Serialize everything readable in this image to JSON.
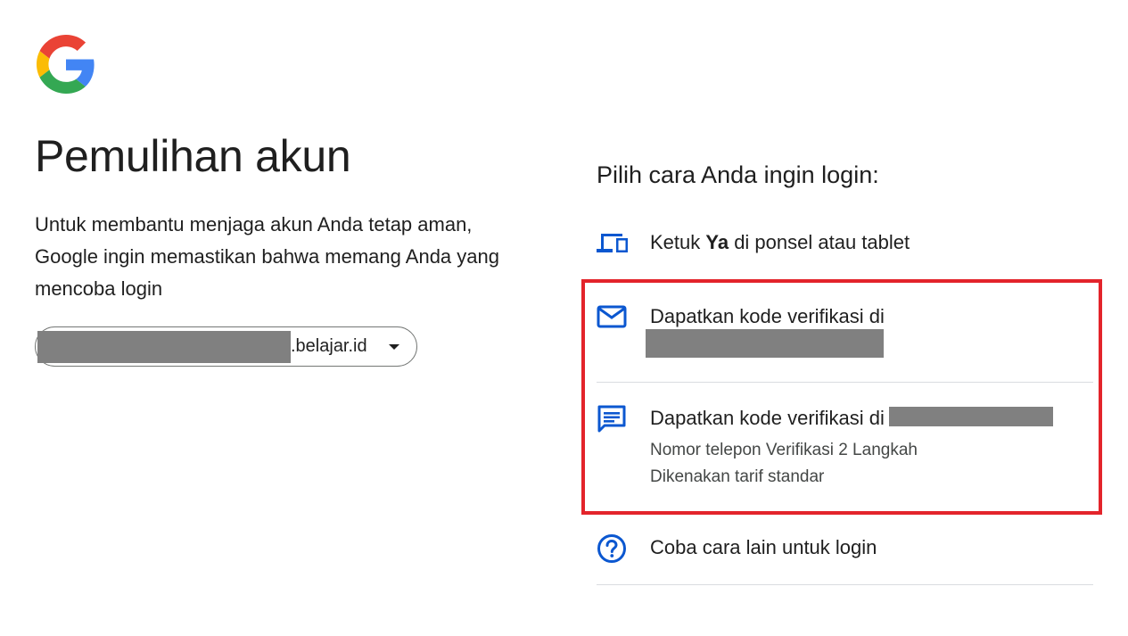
{
  "page": {
    "title": "Pemulihan akun",
    "description": "Untuk membantu menjaga akun Anda tetap aman, Google ingin memastikan bahwa memang Anda yang mencoba login"
  },
  "account": {
    "email_suffix": ".belajar.id"
  },
  "options": {
    "prompt": "Pilih cara Anda ingin login:",
    "tap_yes": {
      "prefix": "Ketuk ",
      "bold": "Ya",
      "suffix": " di ponsel atau tablet",
      "icon": "devices-icon"
    },
    "email_code": {
      "label": "Dapatkan kode verifikasi di",
      "icon": "mail-icon"
    },
    "sms_code": {
      "label": "Dapatkan kode verifikasi di",
      "line2": "Nomor telepon Verifikasi 2 Langkah",
      "line3": "Dikenakan tarif standar",
      "icon": "sms-icon"
    },
    "other": {
      "label": "Coba cara lain untuk login",
      "icon": "help-circle-icon"
    }
  },
  "colors": {
    "icon_blue": "#0b57d0",
    "highlight_red": "#e3242b",
    "redaction_gray": "#808080"
  }
}
